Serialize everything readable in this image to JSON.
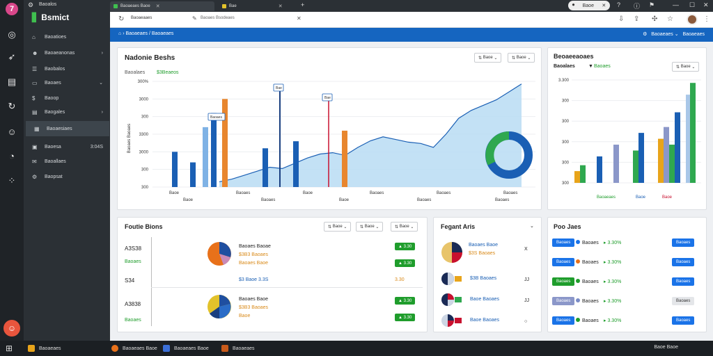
{
  "sidebar": {
    "top_text": "Baoalos",
    "brand": "Bsmict",
    "items": [
      {
        "label": "Baoatioes",
        "icon": "home-icon",
        "trail": ""
      },
      {
        "label": "Baoaeanonas",
        "icon": "people-icon",
        "trail": "›"
      },
      {
        "label": "Baobalos",
        "icon": "list-icon",
        "trail": ""
      },
      {
        "label": "Baoaes",
        "icon": "folder-icon",
        "trail": "⌄"
      },
      {
        "label": "Baoop",
        "icon": "dollar-icon",
        "trail": ""
      },
      {
        "label": "Baogales",
        "icon": "document-icon",
        "trail": "›"
      },
      {
        "label": "Baoaesiaes",
        "icon": "chart-icon",
        "trail": ""
      },
      {
        "label": "Baoesa",
        "icon": "calendar-icon",
        "trail": "3:04S"
      },
      {
        "label": "Baoallaes",
        "icon": "mail-icon",
        "trail": ""
      },
      {
        "label": "Baopsat",
        "icon": "settings-icon",
        "trail": ""
      }
    ]
  },
  "browser": {
    "tabs": [
      {
        "label": "Baoaeaes Baoe"
      },
      {
        "label": "Bae"
      }
    ],
    "url": "Baoaeaaes",
    "url_path": "Baoaes Bsodeaes",
    "header_link": "Baoaeaes",
    "window_label": "Baoe"
  },
  "bluebar": {
    "breadcrumb": "Baoaeaes",
    "breadcrumb_sep": "/",
    "breadcrumb_2": "Baoaeaes",
    "right_label": "Baoaeaes"
  },
  "main_chart": {
    "title": "Nadonie Beshs",
    "subtitle": "Baoalaes",
    "subtitle_value": "$3Beaeos",
    "filter_1": "Baoe",
    "filter_2": "Baoe",
    "y_ticks": [
      "300%",
      "3000",
      "300",
      "3300",
      "3000",
      "300",
      "300"
    ],
    "x_ticks": [
      "Baoe",
      "Baoaes",
      "Baoe",
      "Baoaes",
      "Baoaes",
      "Baoaes"
    ],
    "x_ticks_2": [
      "Baoe",
      "Baoaes",
      "Baoe",
      "Baoaes",
      "Baoaes"
    ],
    "ylabel": "Baoaes Baoaes",
    "callouts": [
      "Baoaes",
      "Bae",
      "Bae"
    ]
  },
  "chart_data": {
    "type": "line",
    "title": "",
    "xlabel": "",
    "ylabel": "",
    "series": [
      {
        "values": [
          4,
          6,
          9,
          12,
          15,
          14,
          18,
          22,
          25,
          26,
          24,
          30,
          35,
          38,
          36,
          34,
          33,
          30,
          40,
          52,
          58,
          62,
          66,
          72,
          78
        ]
      }
    ],
    "bars": [
      20,
      14,
      34,
      42,
      50,
      22,
      26,
      32
    ]
  },
  "right_chart": {
    "title": "Beoaeeaoaes",
    "subtitle": "Baoalaes",
    "subtitle_2": "Baoaes",
    "filter": "Baoe",
    "y_ticks": [
      "3.300",
      "300",
      "300",
      "300",
      "300",
      "300"
    ],
    "legend_1": "Baoaeaes",
    "legend_2": "Baoe",
    "legend_3": "Baoe"
  },
  "right_chart_data": {
    "type": "bar",
    "values": [
      8,
      12,
      18,
      26,
      22,
      34,
      30,
      38,
      26,
      48,
      60,
      68
    ]
  },
  "card_portfolio": {
    "title": "Foutie Bions",
    "filter_1": "Baoe",
    "filter_2": "Baoe",
    "filter_3": "Baoe",
    "rows": [
      {
        "left": "A3S38",
        "left_sub": "Baoaes",
        "title": "Baoaes Baoae",
        "sub1": "$3B3 Baoaes",
        "sub2": "Baoaes Baoe",
        "badge_1": "3.30",
        "badge_2": "3.30"
      },
      {
        "left": "S34",
        "left_sub": "",
        "title": "$3 Baoe 3.3S",
        "sub1": "",
        "sub2": "",
        "badge_1": "3.30",
        "badge_2": ""
      },
      {
        "left": "A3838",
        "left_sub": "Baoaes",
        "title": "Baoaes Baoe",
        "sub1": "$3B3 Baoaes",
        "sub2": "Baoe",
        "badge_1": "3.30",
        "badge_2": "3.30"
      }
    ]
  },
  "card_payment": {
    "title": "Fegant Aris",
    "rows": [
      {
        "title": "Baoaes Baoe",
        "sub": "$3S Baoaes",
        "trail": "X"
      },
      {
        "title": "$3B Baoaes",
        "sub": "",
        "trail": "JJ"
      },
      {
        "title": "Baoe Baoaes",
        "sub": "",
        "trail": "JJ"
      },
      {
        "title": "Baoe Baoaes",
        "sub": "",
        "trail": "○"
      }
    ]
  },
  "card_pool": {
    "title": "Poo Jaes",
    "rows": [
      {
        "label": "Baoaes",
        "mid": "Baoaes",
        "pct": "3.30%",
        "badge": "Baoaes",
        "color": "#1a73e8"
      },
      {
        "label": "Baoaes",
        "mid": "Baoaes",
        "pct": "3.30%",
        "badge": "Baoaes",
        "color": "#e8711a"
      },
      {
        "label": "Baoaes",
        "mid": "Baoaes",
        "pct": "3.30%",
        "badge": "Baoaes",
        "color": "#1f9d2c"
      },
      {
        "label": "Baoaes",
        "mid": "Baoaes",
        "pct": "3.30%",
        "badge": "Baoaes",
        "color": "#7a8cc7"
      },
      {
        "label": "Baoaes",
        "mid": "Baoaes",
        "pct": "3.30%",
        "badge": "Baoaes",
        "color": "#1f9d2c"
      }
    ]
  },
  "taskbar": {
    "items": [
      "Baoaeaes",
      "Baoaeaes Baoe",
      "Baoaeaes Baoe",
      "Baoaeaes"
    ],
    "clock": "Baoe Baoe"
  }
}
